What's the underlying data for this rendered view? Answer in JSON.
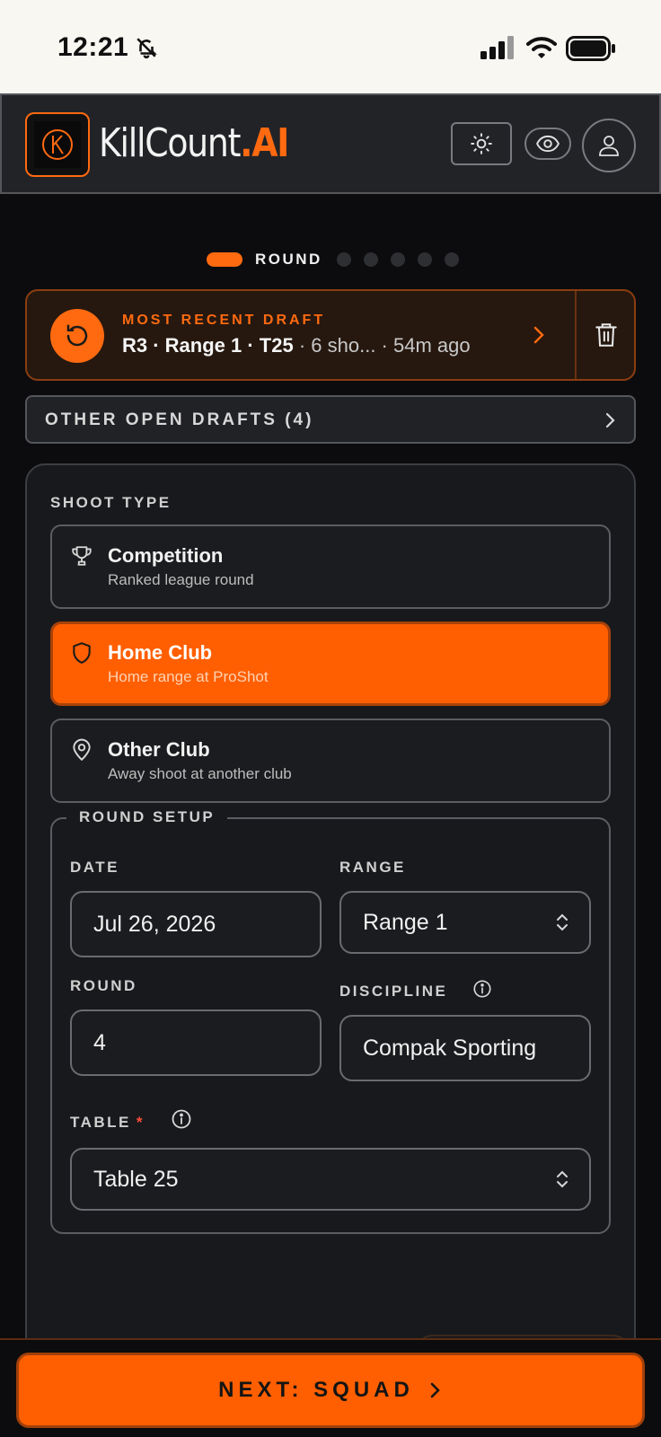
{
  "status_bar": {
    "time": "12:21"
  },
  "header": {
    "brand_main": "KillCount",
    "brand_accent": ".AI"
  },
  "stepper": {
    "active_label": "ROUND",
    "total_steps": 6,
    "current_step": 1
  },
  "draft": {
    "kicker": "MOST RECENT DRAFT",
    "title": "R3 · Range 1 · T25",
    "shots": " · 6 sho...",
    "age": " · 54m ago"
  },
  "other_drafts": {
    "label": "OTHER OPEN DRAFTS (4)"
  },
  "shoot_type": {
    "label": "SHOOT TYPE",
    "options": [
      {
        "title": "Competition",
        "subtitle": "Ranked league round",
        "icon": "trophy-icon",
        "selected": false
      },
      {
        "title": "Home Club",
        "subtitle": "Home range at ProShot",
        "icon": "shield-icon",
        "selected": true
      },
      {
        "title": "Other Club",
        "subtitle": "Away shoot at another club",
        "icon": "map-pin-icon",
        "selected": false
      }
    ]
  },
  "round_setup": {
    "legend": "ROUND SETUP",
    "date": {
      "label": "DATE",
      "value": "Jul 26, 2026"
    },
    "range": {
      "label": "RANGE",
      "value": "Range 1"
    },
    "round": {
      "label": "ROUND",
      "value": "4"
    },
    "discipline": {
      "label": "DISCIPLINE",
      "value": "Compak Sporting"
    },
    "table": {
      "label": "TABLE",
      "required_mark": "*",
      "value": "Table 25"
    }
  },
  "footer": {
    "next_label": "NEXT: SQUAD"
  },
  "colors": {
    "accent": "#ff6a10",
    "background": "#0c0c0e",
    "panel": "#18191c"
  }
}
